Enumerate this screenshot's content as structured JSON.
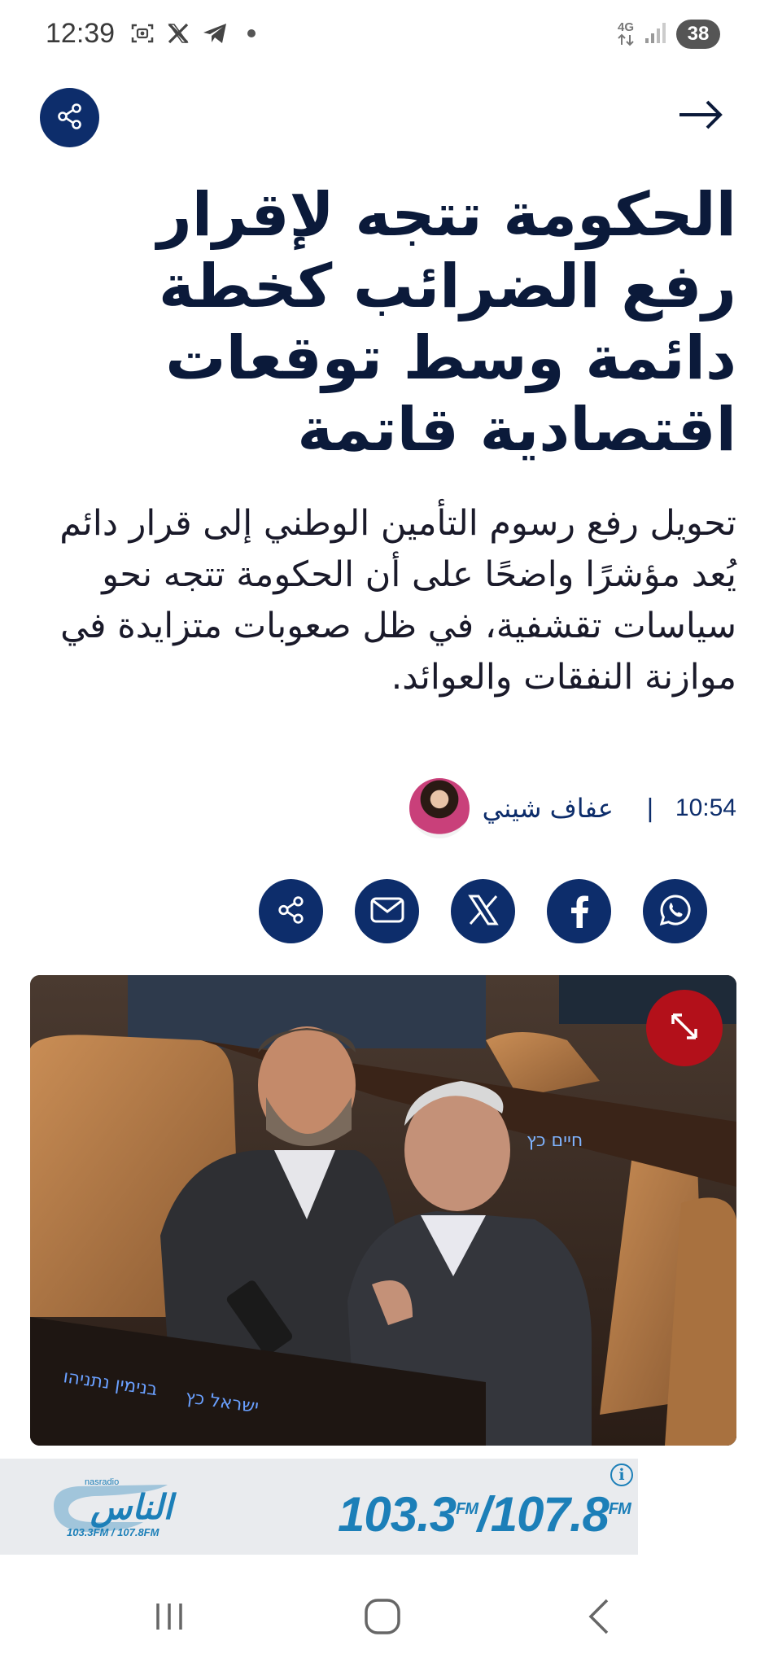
{
  "status_bar": {
    "time": "12:39",
    "network_label": "4G",
    "battery_level": "38",
    "icons": [
      "screenshot-icon",
      "x-icon",
      "telegram-icon",
      "dot-icon",
      "data-arrows-icon",
      "signal-icon"
    ]
  },
  "header": {
    "share_icon": "share-icon",
    "back_icon": "arrow-right-icon"
  },
  "article": {
    "headline": "الحكومة تتجه لإقرار رفع الضرائب كخطة دائمة وسط توقعات اقتصادية قاتمة",
    "summary": "تحويل رفع رسوم التأمين الوطني إلى قرار دائم يُعد مؤشرًا واضحًا على أن الحكومة تتجه نحو سياسات تقشفية، في ظل صعوبات متزايدة في موازنة النفقات والعوائد.",
    "author": "عفاف شيني",
    "separator": "|",
    "time": "10:54"
  },
  "share_buttons": [
    {
      "icon": "whatsapp-icon"
    },
    {
      "icon": "facebook-icon"
    },
    {
      "icon": "x-icon"
    },
    {
      "icon": "mail-icon"
    },
    {
      "icon": "share-icon"
    }
  ],
  "photo": {
    "expand_icon": "expand-icon"
  },
  "ad": {
    "brand_logo": "الناس",
    "logo_tagline": "nasradio",
    "logo_freqs": "103.3FM / 107.8FM",
    "frequencies_a": "103.3",
    "fm_a": "FM",
    "slash": "/",
    "frequencies_b": "107.8",
    "fm_b": "FM",
    "info_label": "i"
  },
  "navigation": {
    "icons": [
      "recent-apps-icon",
      "home-icon",
      "back-icon"
    ]
  },
  "colors": {
    "brand_navy": "#0d2d6b",
    "headline": "#0b1a3a",
    "expand_red": "#b3101a",
    "ad_blue": "#1c7fb8"
  }
}
